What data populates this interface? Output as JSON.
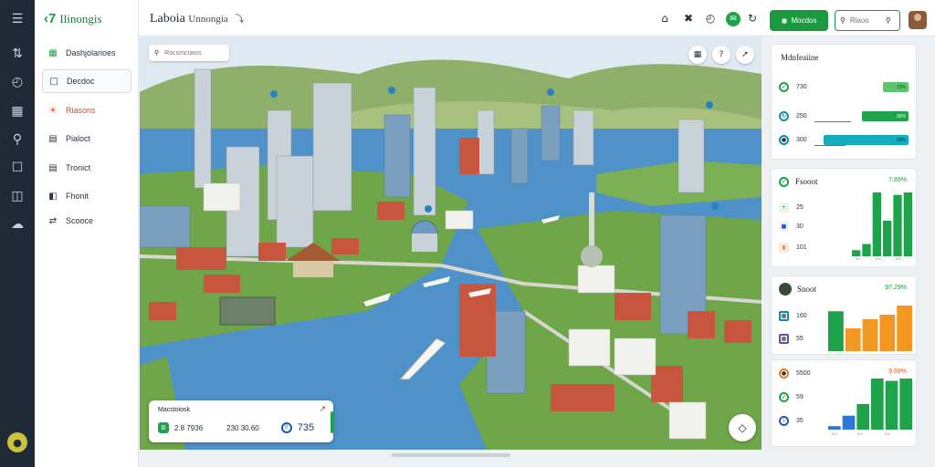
{
  "rail": {
    "icons": [
      "menu-icon",
      "routes-icon",
      "time-icon",
      "buildings-icon",
      "search-map-icon",
      "chat-icon",
      "layout-icon",
      "cloud-icon"
    ]
  },
  "sidebar": {
    "brand": "Ilinongis",
    "items": [
      {
        "label": "Dashjolarioes",
        "icon": "grid-icon"
      },
      {
        "label": "Decdoc",
        "icon": "document-icon",
        "active": true
      },
      {
        "label": "Riasons",
        "icon": "sun-icon",
        "highlight": true
      },
      {
        "label": "Pialoct",
        "icon": "notes-icon"
      },
      {
        "label": "Tronict",
        "icon": "list-icon"
      },
      {
        "label": "Fhonit",
        "icon": "book-icon"
      },
      {
        "label": "Scooce",
        "icon": "swap-icon"
      }
    ]
  },
  "header": {
    "title": "Laboia",
    "subtitle": "Unnongia",
    "primary_button": "Mocdos",
    "search_placeholder": "Rlaoo"
  },
  "map": {
    "search_placeholder": "Rocsmcraios",
    "card": {
      "title": "Macstoiosk",
      "badge": "B",
      "value1": "2.8  7936",
      "value2": "230  30.60",
      "circle": "0",
      "big_value": "735"
    }
  },
  "panel1": {
    "title": "Mdnfeaiine",
    "rows": [
      {
        "label": "730",
        "bar_text": "72%",
        "fraction": 0.25
      },
      {
        "label": "250",
        "bar_text": "90%",
        "fraction": 0.5
      },
      {
        "label": "300",
        "bar_text": "99%",
        "fraction": 0.9
      }
    ]
  },
  "panel2": {
    "title": "Fsooot",
    "pct": "7.89%",
    "rows": [
      "25",
      "30",
      "101"
    ],
    "chart_data": {
      "type": "bar",
      "values": [
        5,
        10,
        52,
        29,
        50,
        52
      ],
      "colors": [
        "#1fa34a",
        "#1fa34a",
        "#1fa34a",
        "#1fa34a",
        "#1fa34a",
        "#1fa34a"
      ],
      "x_labels": [
        "0:0",
        "0:0",
        "0:0"
      ]
    }
  },
  "panel3": {
    "title": "Snoot",
    "pct": "97.29%",
    "rows": [
      "160",
      "55"
    ],
    "chart_data": {
      "type": "bar",
      "values": [
        35,
        20,
        28,
        32,
        40
      ],
      "colors": [
        "#1fa34a",
        "#f19722",
        "#f19722",
        "#f19722",
        "#f19722"
      ]
    }
  },
  "panel4": {
    "title": "",
    "pct": "9.89%",
    "rows": [
      "5500",
      "59",
      "35"
    ],
    "chart_data": {
      "type": "bar",
      "values": [
        3,
        12,
        22,
        44,
        42,
        44
      ],
      "colors": [
        "#2c78d8",
        "#2c78d8",
        "#1fa34a",
        "#1fa34a",
        "#1fa34a",
        "#1fa34a"
      ],
      "x_labels": [
        "0:0",
        "0:0",
        "0:0"
      ]
    }
  },
  "colors": {
    "accent": "#1a9a3e",
    "rail": "#1e2a36",
    "water": "#4f91c9"
  }
}
